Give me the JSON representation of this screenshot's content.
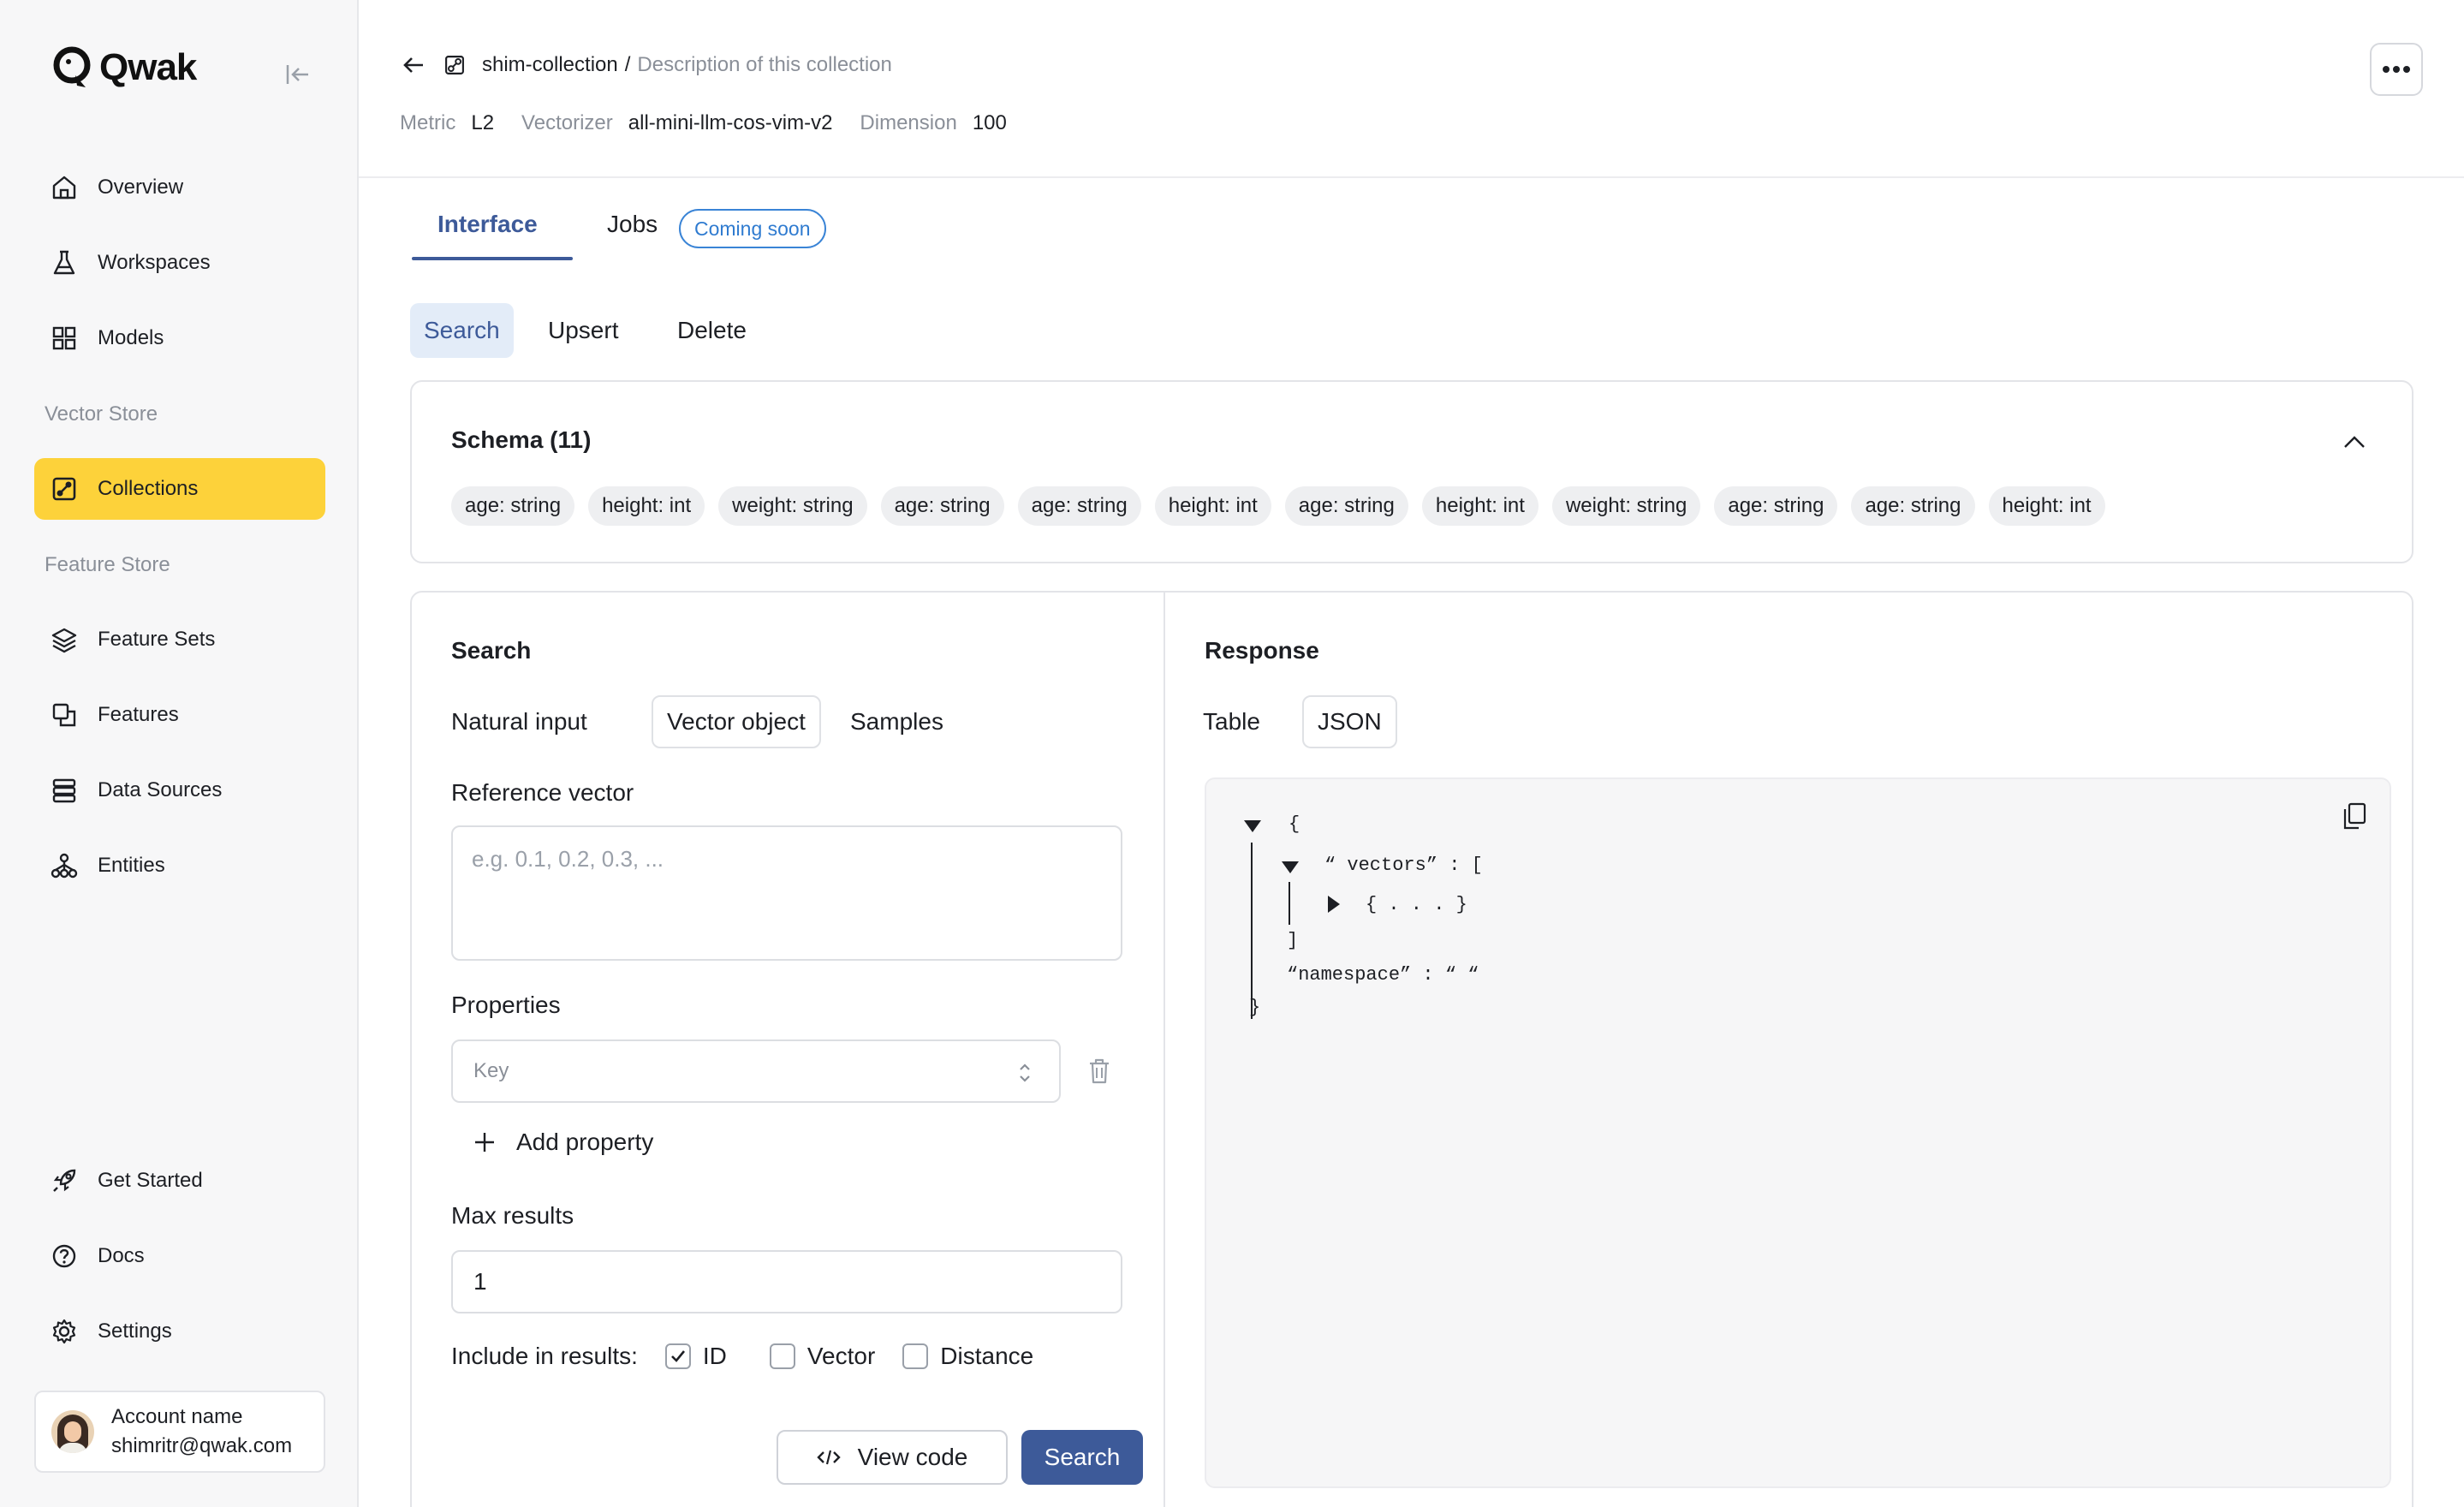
{
  "brand": {
    "name": "Qwak"
  },
  "sidebar": {
    "items_top": [
      {
        "label": "Overview",
        "icon": "home-icon"
      },
      {
        "label": "Workspaces",
        "icon": "flask-icon"
      },
      {
        "label": "Models",
        "icon": "grid-icon"
      }
    ],
    "section_vector": "Vector Store",
    "vector_items": [
      {
        "label": "Collections",
        "icon": "collection-icon",
        "active": true
      }
    ],
    "section_feature": "Feature Store",
    "feature_items": [
      {
        "label": "Feature Sets",
        "icon": "layers-icon"
      },
      {
        "label": "Features",
        "icon": "copy-icon"
      },
      {
        "label": "Data Sources",
        "icon": "database-icon"
      },
      {
        "label": "Entities",
        "icon": "hierarchy-icon"
      }
    ],
    "bottom_items": [
      {
        "label": "Get Started",
        "icon": "rocket-icon"
      },
      {
        "label": "Docs",
        "icon": "help-icon"
      },
      {
        "label": "Settings",
        "icon": "gear-icon"
      }
    ],
    "account": {
      "name": "Account name",
      "email": "shimritr@qwak.com"
    }
  },
  "header": {
    "collection": "shim-collection",
    "separator": "/",
    "description": "Description of this collection",
    "meta": [
      {
        "key": "Metric",
        "value": "L2"
      },
      {
        "key": "Vectorizer",
        "value": "all-mini-llm-cos-vim-v2"
      },
      {
        "key": "Dimension",
        "value": "100"
      }
    ]
  },
  "tabs": {
    "interface": "Interface",
    "jobs": "Jobs",
    "badge": "Coming soon"
  },
  "subtabs": [
    "Search",
    "Upsert",
    "Delete"
  ],
  "schema": {
    "title": "Schema (11)",
    "fields": [
      "age: string",
      "height: int",
      "weight: string",
      "age: string",
      "age: string",
      "height: int",
      "age: string",
      "height: int",
      "weight: string",
      "age: string",
      "age: string",
      "height: int"
    ]
  },
  "search": {
    "title": "Search",
    "modes": [
      "Natural input",
      "Vector object",
      "Samples"
    ],
    "ref_label": "Reference vector",
    "ref_placeholder": "e.g. 0.1, 0.2, 0.3, ...",
    "props_label": "Properties",
    "key_placeholder": "Key",
    "add_property": "Add property",
    "max_label": "Max results",
    "max_value": "1",
    "include_label": "Include in results:",
    "include_options": [
      {
        "label": "ID",
        "checked": true
      },
      {
        "label": "Vector",
        "checked": false
      },
      {
        "label": "Distance",
        "checked": false
      }
    ],
    "view_code": "View code",
    "search_btn": "Search"
  },
  "response": {
    "title": "Response",
    "modes": [
      "Table",
      "JSON"
    ],
    "json": {
      "open_brace": "{",
      "vectors_line": "“ vectors” : [",
      "collapsed": "{ . . . }",
      "close_bracket": "]",
      "namespace_line": "“namespace” : “ “",
      "close_brace": "}"
    }
  },
  "colors": {
    "accent": "#3d5a99",
    "active_nav": "#fdd23a",
    "badge": "#2f7bd0"
  }
}
